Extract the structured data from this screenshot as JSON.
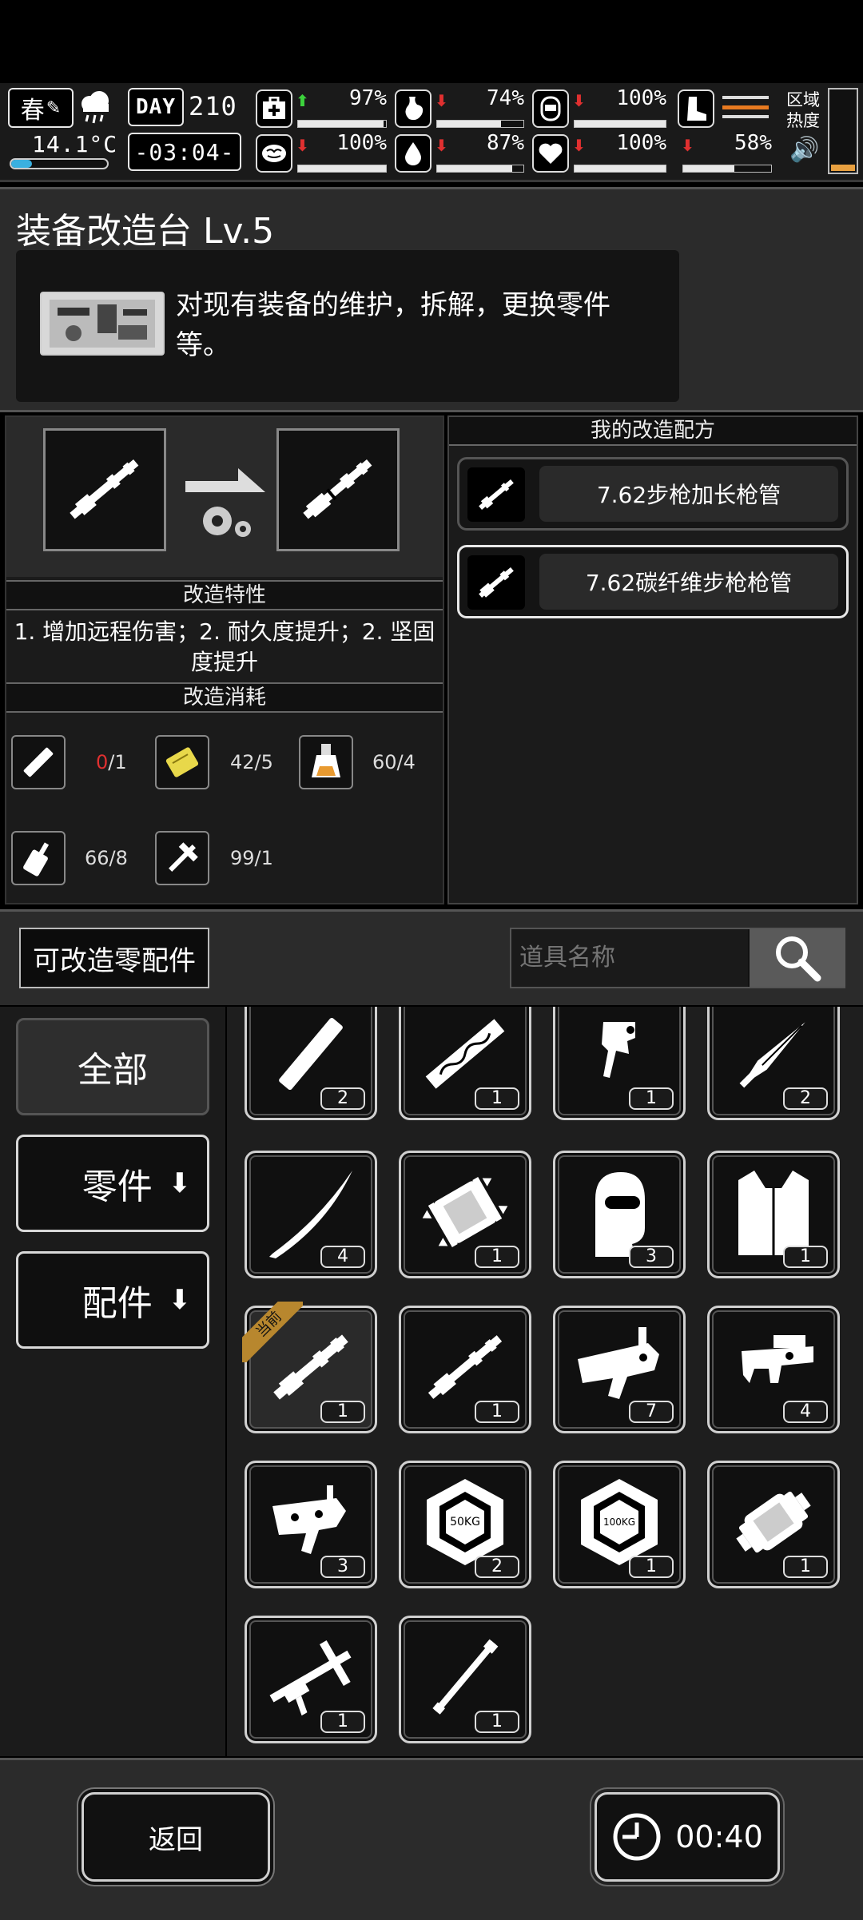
{
  "status": {
    "season": "春",
    "temperature": "14.1°C",
    "day_label": "DAY",
    "day_number": "210",
    "time": "-03:04-",
    "stats": [
      {
        "name": "health",
        "icon": "medkit-icon",
        "trend": "up",
        "value": "97%",
        "fill": 0.97
      },
      {
        "name": "hunger",
        "icon": "stomach-icon",
        "trend": "down",
        "value": "74%",
        "fill": 0.74
      },
      {
        "name": "energy",
        "icon": "bottle-icon",
        "trend": "down",
        "value": "100%",
        "fill": 1.0
      },
      {
        "name": "mood",
        "icon": "brain-icon",
        "trend": "down",
        "value": "100%",
        "fill": 1.0
      },
      {
        "name": "thirst",
        "icon": "water-drop-icon",
        "trend": "down",
        "value": "87%",
        "fill": 0.87
      },
      {
        "name": "heart",
        "icon": "heart-icon",
        "trend": "down",
        "value": "100%",
        "fill": 1.0
      },
      {
        "name": "stamina",
        "icon": "boot-icon",
        "trend": "down",
        "value": "58%",
        "fill": 0.58
      }
    ],
    "area_heat_label": "区域热度"
  },
  "station": {
    "title": "装备改造台 Lv.5",
    "description": "对现有装备的维护，拆解，更换零件等。"
  },
  "modify": {
    "traits_header": "改造特性",
    "traits_text": "1. 增加远程伤害；2. 耐久度提升；2. 坚固度提升",
    "cost_header": "改造消耗",
    "costs": [
      {
        "icon": "tube-icon",
        "have": "0",
        "need": "/1",
        "insufficient": true
      },
      {
        "icon": "card-icon",
        "have": "42",
        "need": "/5",
        "insufficient": false
      },
      {
        "icon": "flask-icon",
        "have": "60",
        "need": "/4",
        "insufficient": false
      },
      {
        "icon": "oil-can-icon",
        "have": "66",
        "need": "/8",
        "insufficient": false
      },
      {
        "icon": "tool-icon",
        "have": "99",
        "need": "/1",
        "insufficient": false
      }
    ]
  },
  "recipes": {
    "header": "我的改造配方",
    "items": [
      {
        "label": "7.62步枪加长枪管",
        "selected": false
      },
      {
        "label": "7.62碳纤维步枪枪管",
        "selected": true
      }
    ]
  },
  "filter": {
    "title": "可改造零配件",
    "search_placeholder": "道具名称"
  },
  "categories": [
    {
      "label": "全部",
      "active": true,
      "has_arrow": false
    },
    {
      "label": "零件",
      "active": false,
      "has_arrow": true
    },
    {
      "label": "配件",
      "active": false,
      "has_arrow": true
    }
  ],
  "items": [
    {
      "icon": "tube-icon",
      "count": "2"
    },
    {
      "icon": "carved-barrel-icon",
      "count": "1"
    },
    {
      "icon": "trigger-icon",
      "count": "1"
    },
    {
      "icon": "spearhead-icon",
      "count": "2"
    },
    {
      "icon": "katana-blade-icon",
      "count": "4"
    },
    {
      "icon": "spiked-cylinder-icon",
      "count": "1"
    },
    {
      "icon": "balaclava-icon",
      "count": "3"
    },
    {
      "icon": "vest-icon",
      "count": "1"
    },
    {
      "icon": "rifle-barrel-icon",
      "count": "1",
      "current": true,
      "current_label": "当前"
    },
    {
      "icon": "rifle-barrel-icon",
      "count": "1"
    },
    {
      "icon": "receiver-icon",
      "count": "7"
    },
    {
      "icon": "pistol-frame-icon",
      "count": "4"
    },
    {
      "icon": "trigger-group-icon",
      "count": "3"
    },
    {
      "icon": "weight-50kg-icon",
      "count": "2",
      "text": "50KG"
    },
    {
      "icon": "weight-100kg-icon",
      "count": "1",
      "text": "100KG"
    },
    {
      "icon": "roller-icon",
      "count": "1"
    },
    {
      "icon": "crossbow-icon",
      "count": "1"
    },
    {
      "icon": "rod-icon",
      "count": "1"
    }
  ],
  "footer": {
    "back_label": "返回",
    "timer": "00:40"
  },
  "colors": {
    "insufficient": "#e03030",
    "up": "#3cd23c",
    "down": "#e03030",
    "current_tag": "#b8872e"
  }
}
